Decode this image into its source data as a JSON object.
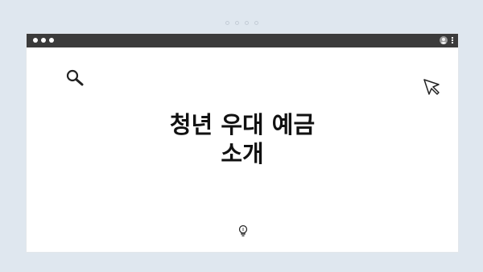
{
  "headline": {
    "line1": "청년 우대 예금",
    "line2": "소개"
  },
  "icons": {
    "search": "search-icon",
    "cursor": "cursor-icon",
    "bulb": "lightbulb-icon",
    "user": "user-icon",
    "menu": "kebab-menu-icon"
  },
  "colors": {
    "background": "#dfe7ef",
    "titlebar": "#3b3b3b",
    "window": "#ffffff",
    "text": "#111111"
  }
}
